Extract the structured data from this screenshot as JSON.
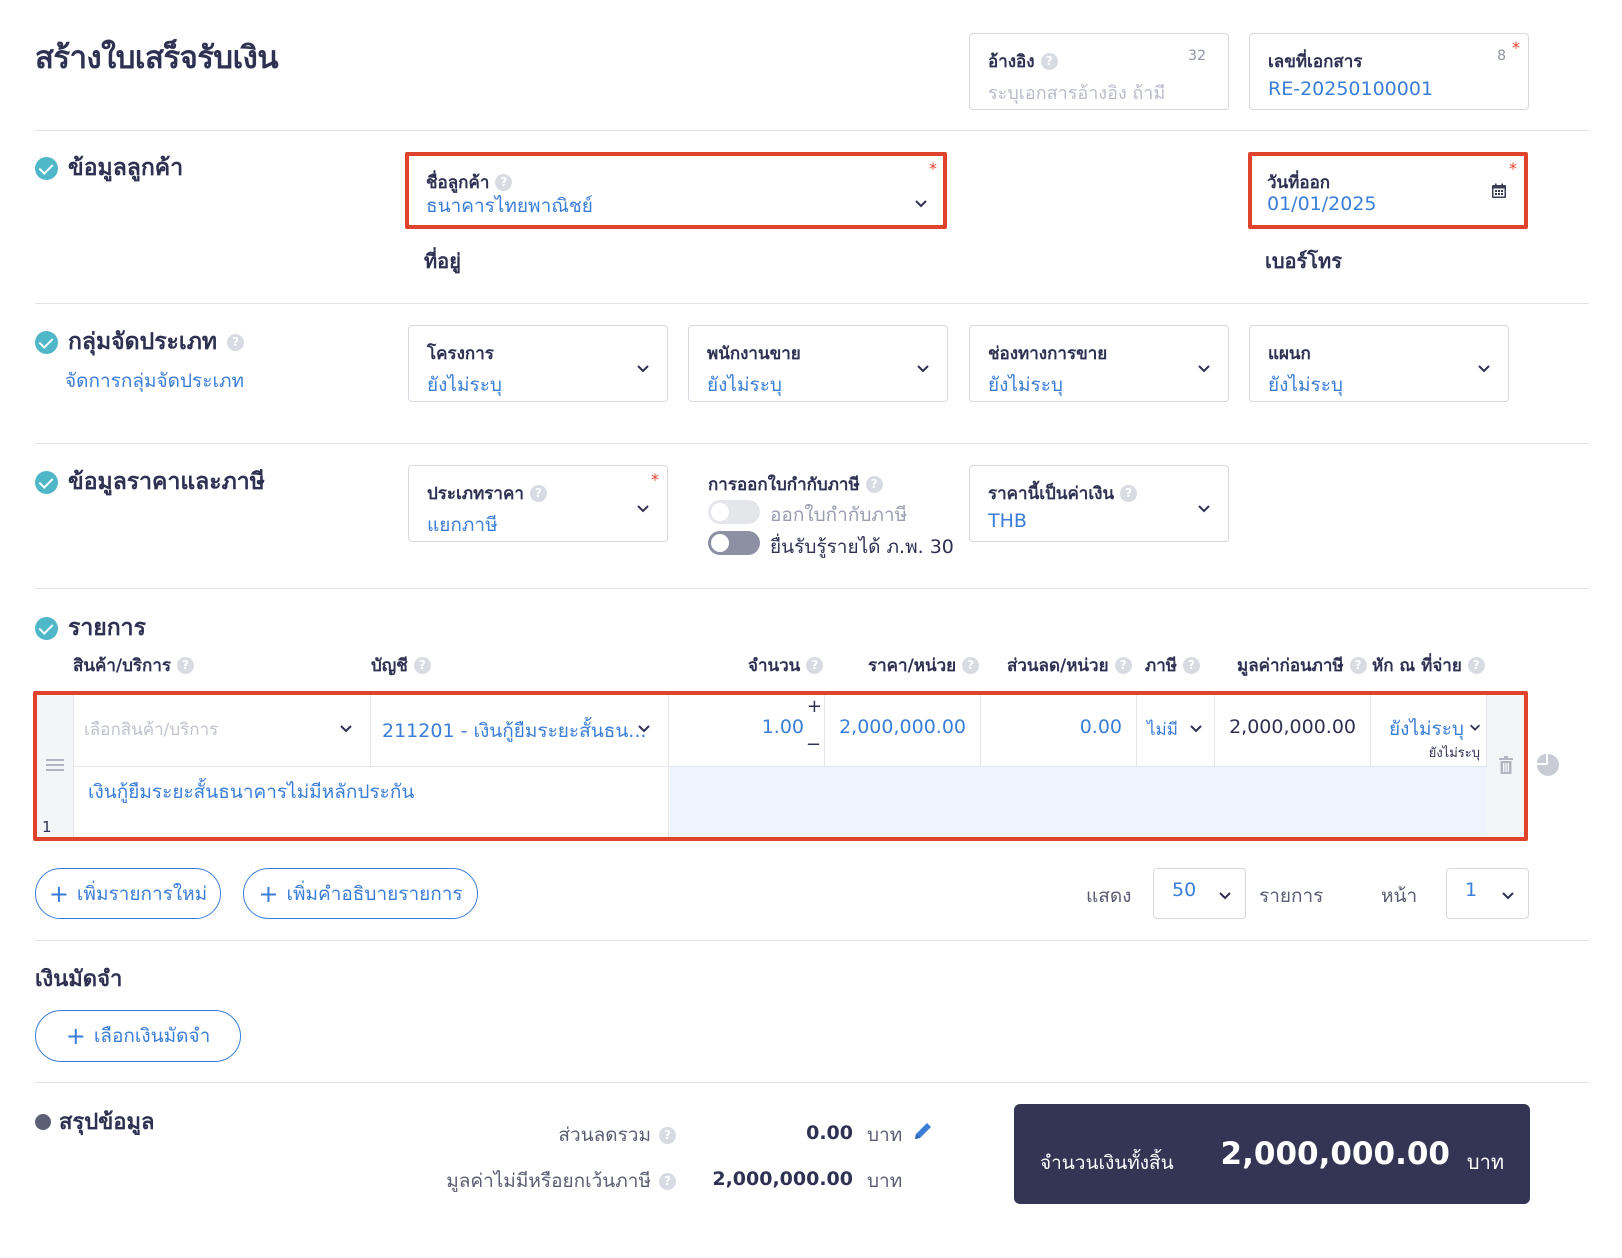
{
  "page": {
    "title": "สร้างใบเสร็จรับเงิน"
  },
  "header_fields": {
    "reference": {
      "label": "อ้างอิง",
      "placeholder": "ระบุเอกสารอ้างอิง ถ้ามี",
      "counter": "32"
    },
    "doc_number": {
      "label": "เลขที่เอกสาร",
      "value": "RE-20250100001",
      "counter": "8",
      "required": "*"
    }
  },
  "customer_section": {
    "heading": "ข้อมูลลูกค้า",
    "customer_name": {
      "label": "ชื่อลูกค้า",
      "value": "ธนาคารไทยพาณิชย์",
      "required": "*"
    },
    "issue_date": {
      "label": "วันที่ออก",
      "value": "01/01/2025",
      "required": "*"
    },
    "address_label": "ที่อยู่",
    "phone_label": "เบอร์โทร"
  },
  "category_section": {
    "heading": "กลุ่มจัดประเภท",
    "manage_link": "จัดการกลุ่มจัดประเภท",
    "fields": [
      {
        "label": "โครงการ",
        "value": "ยังไม่ระบุ"
      },
      {
        "label": "พนักงานขาย",
        "value": "ยังไม่ระบุ"
      },
      {
        "label": "ช่องทางการขาย",
        "value": "ยังไม่ระบุ"
      },
      {
        "label": "แผนก",
        "value": "ยังไม่ระบุ"
      }
    ]
  },
  "pricing_section": {
    "heading": "ข้อมูลราคาและภาษี",
    "price_type": {
      "label": "ประเภทราคา",
      "value": "แยกภาษี",
      "required": "*"
    },
    "tax_invoice": {
      "label": "การออกใบกำกับภาษี",
      "toggle1_label": "ออกใบกำกับภาษี",
      "toggle2_label": "ยื่นรับรู้รายได้ ภ.พ. 30"
    },
    "currency": {
      "label": "ราคานี้เป็นค่าเงิน",
      "value": "THB"
    }
  },
  "items_section": {
    "heading": "รายการ",
    "columns": [
      "สินค้า/บริการ",
      "บัญชี",
      "จำนวน",
      "ราคา/หน่วย",
      "ส่วนลด/หน่วย",
      "ภาษี",
      "มูลค่าก่อนภาษี",
      "หัก ณ ที่จ่าย"
    ],
    "rows": [
      {
        "index": "1",
        "product_placeholder": "เลือกสินค้า/บริการ",
        "account": "211201 - เงินกู้ยืมระยะสั้นธน...",
        "quantity": "1.00",
        "unit_price": "2,000,000.00",
        "discount": "0.00",
        "tax": "ไม่มี",
        "pre_tax_value": "2,000,000.00",
        "withholding": "ยังไม่ระบุ",
        "withholding_sub": "ยังไม่ระบุ",
        "description": "เงินกู้ยืมระยะสั้นธนาคารไม่มีหลักประกัน"
      }
    ],
    "add_item_button": "เพิ่มรายการใหม่",
    "add_desc_button": "เพิ่มคำอธิบายรายการ",
    "pagination": {
      "show_label": "แสดง",
      "per_page": "50",
      "items_label": "รายการ",
      "page_label": "หน้า",
      "page": "1"
    }
  },
  "deposit_section": {
    "heading": "เงินมัดจำ",
    "select_button": "เลือกเงินมัดจำ"
  },
  "summary_section": {
    "heading": "สรุปข้อมูล",
    "total_discount_label": "ส่วนลดรวม",
    "total_discount_value": "0.00",
    "non_taxable_label": "มูลค่าไม่มีหรือยกเว้นภาษี",
    "non_taxable_value": "2,000,000.00",
    "currency_unit": "บาท",
    "grand_total_label": "จำนวนเงินทั้งสิ้น",
    "grand_total_value": "2,000,000.00",
    "grand_total_unit": "บาท"
  },
  "colors": {
    "accent": "#3b7ed8",
    "highlight": "#e0432c",
    "check": "#4fb7c8",
    "total_bg": "#343554"
  }
}
